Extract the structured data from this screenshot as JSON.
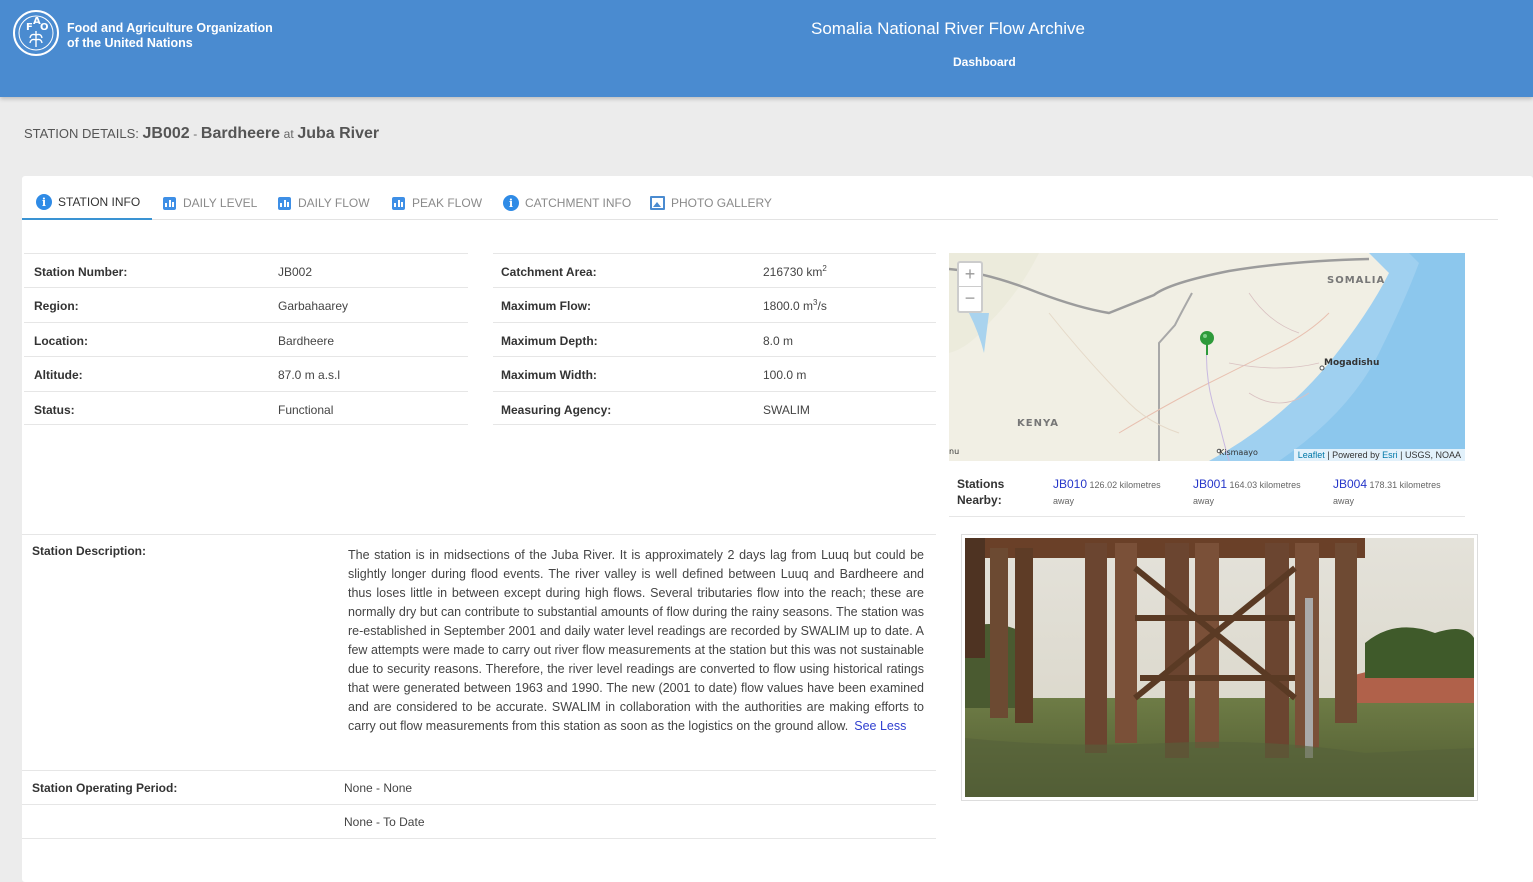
{
  "header": {
    "org_line1": "Food and Agriculture Organization",
    "org_line2": "of the United Nations",
    "app_title": "Somalia National River Flow Archive",
    "nav_dashboard": "Dashboard"
  },
  "station_header": {
    "prefix": "STATION DETAILS:",
    "code": "JB002",
    "sep": "-",
    "name": "Bardheere",
    "at": "at",
    "river": "Juba River"
  },
  "tabs": [
    {
      "label": "STATION INFO",
      "icon": "info-icon",
      "active": true
    },
    {
      "label": "DAILY LEVEL",
      "icon": "bar-chart-icon"
    },
    {
      "label": "DAILY FLOW",
      "icon": "bar-chart-icon"
    },
    {
      "label": "PEAK FLOW",
      "icon": "bar-chart-icon"
    },
    {
      "label": "CATCHMENT INFO",
      "icon": "info-icon"
    },
    {
      "label": "PHOTO GALLERY",
      "icon": "photo-icon"
    }
  ],
  "info_left": [
    {
      "label": "Station Number:",
      "value": "JB002"
    },
    {
      "label": "Region:",
      "value": "Garbahaarey"
    },
    {
      "label": "Location:",
      "value": "Bardheere"
    },
    {
      "label": "Altitude:",
      "value": "87.0 m a.s.l"
    },
    {
      "label": "Status:",
      "value": "Functional"
    }
  ],
  "info_right": [
    {
      "label": "Catchment Area:",
      "value": "216730 km",
      "sup": "2"
    },
    {
      "label": "Maximum Flow:",
      "value": "1800.0 m",
      "sup": "3",
      "suffix": "/s"
    },
    {
      "label": "Maximum Depth:",
      "value": "8.0 m"
    },
    {
      "label": "Maximum Width:",
      "value": "100.0 m"
    },
    {
      "label": "Measuring Agency:",
      "value": "SWALIM"
    }
  ],
  "map": {
    "zoom_in": "+",
    "zoom_out": "−",
    "labels": {
      "somalia": "SOMALIA",
      "kenya": "KENYA",
      "mogadishu": "Mogadishu",
      "kismaayo": "Kismaayo",
      "edge": "nu"
    },
    "attribution": {
      "leaflet": "Leaflet",
      "powered": "| Powered by",
      "esri": "Esri",
      "rest": "| USGS, NOAA"
    },
    "colors": {
      "land": "#f1efe4",
      "sea": "#9fd0f0",
      "marker": "#2e9a3a"
    }
  },
  "nearby": {
    "label_line1": "Stations",
    "label_line2": "Nearby:",
    "items": [
      {
        "code": "JB010",
        "dist": "126.02 kilometres",
        "away": "away"
      },
      {
        "code": "JB001",
        "dist": "164.03 kilometres",
        "away": "away"
      },
      {
        "code": "JB004",
        "dist": "178.31 kilometres",
        "away": "away"
      }
    ]
  },
  "description": {
    "label": "Station Description:",
    "text": "The station is in midsections of the Juba River. It is approximately 2 days lag from Luuq but could be slightly longer during flood events. The river valley is well defined between Luuq and Bardheere and thus loses little in between except during high flows. Several tributaries flow into the reach; these are normally dry but can contribute to substantial amounts of flow during the rainy seasons. The station was re-established in September 2001 and daily water level readings are recorded by SWALIM up to date. A few attempts were made to carry out river flow measurements at the station but this was not sustainable due to security reasons. Therefore, the river level readings are converted to flow using historical ratings that were generated between 1963 and 1990. The new (2001 to date) flow values have been examined and are considered to be accurate. SWALIM in collaboration with the authorities are making efforts to carry out flow measurements from this station as soon as the logistics on the ground allow.",
    "see_less": "See Less"
  },
  "operating": {
    "label": "Station Operating Period:",
    "period1": "None - None",
    "period2": "None - To Date"
  },
  "colors": {
    "header": "#4a8bd0",
    "accent": "#3a93d3",
    "link": "#2536c9"
  }
}
